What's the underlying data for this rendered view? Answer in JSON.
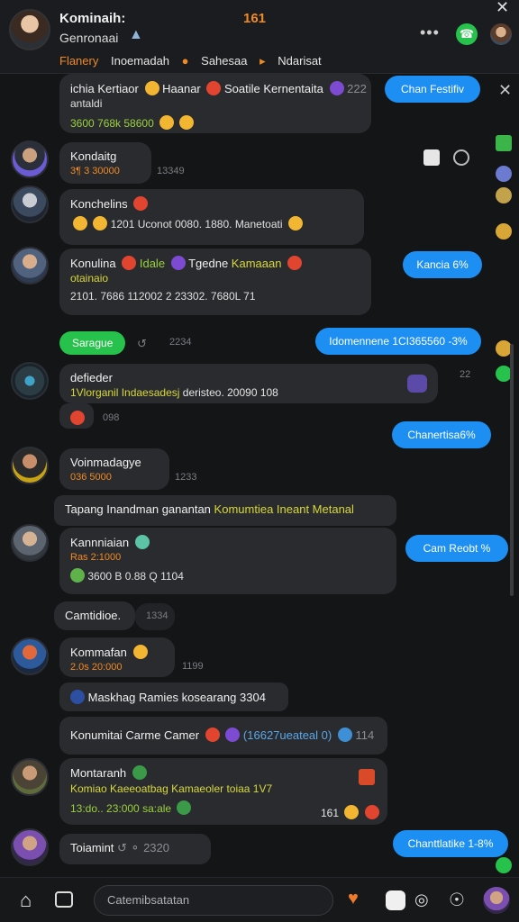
{
  "header": {
    "title": "Kominaih:",
    "count": "161",
    "subtitle": "Genronaai",
    "tabs": [
      "Flanery",
      "Inoemadah",
      "Sahesaa",
      "Ndarisat"
    ],
    "colors": {
      "accent": "#f08a24",
      "online": "#27c24c",
      "link": "#1d8ff2"
    }
  },
  "messages": [
    {
      "name": "ichia  Kertiaor",
      "extra": "Haanar",
      "line2": "antaldi",
      "stats": "3600  768k  58600",
      "extra2": "Soatile Kernentaita",
      "count": "222"
    },
    {
      "name": "Kondaitg",
      "meta": "3¶ 3 30000",
      "time": "13349"
    },
    {
      "name": "Konchelins",
      "stats": "1201  Uconot  0080.  1880.",
      "extra": "Manetoati"
    },
    {
      "name": "Konulina",
      "tag1": "Idale",
      "tag2": "Tgedne",
      "tag3": "Kamaaan",
      "line2": "otainaio",
      "stats": "2101.  7686 112002 2 23302.  7680L  71"
    },
    {
      "name": "defieder",
      "line2": "1Vlorganil Indaesadesj",
      "line3": "deristeo.  20090  108",
      "time": "098",
      "side_num": "22"
    },
    {
      "name": "Voinmadagye",
      "meta": "036 5000",
      "time": "1233"
    },
    {
      "text": "Tapang Inandman ganantan",
      "highlight": "Komumtiea Ineant Metanal"
    },
    {
      "name": "Kannniaian",
      "meta": "Ras 2:1000",
      "stats": "3600 B  0.88 Q  1104"
    },
    {
      "name": "Camtidioe.",
      "time": "1334"
    },
    {
      "name": "Kommafan",
      "meta": "2.0s 20:000",
      "time": "1199"
    },
    {
      "text": "Maskhag Ramies kosearang",
      "num": "3304"
    },
    {
      "text": "Konumitai Carme Camer",
      "mid": "(16627ueateal 0)",
      "num": "114"
    },
    {
      "name": "Montaranh",
      "line2": "Komiao Kaeeoatbag Kamaeoler toiaa 1V7",
      "stats": "13:do..  23:000 sa:ale",
      "num": "161"
    },
    {
      "name": "Toiamint",
      "time": "2320"
    }
  ],
  "pills": {
    "p1": "Chan Festifiv",
    "p2": "Kancia 6%",
    "p3": "Idomennene 1CI365560 -3%",
    "p4": "Chanertisa6%",
    "p5": "Cam Reobt %",
    "p6": "Chanttlatike 1-8%",
    "green": "Sarague",
    "green_time": "2234"
  },
  "composer": {
    "placeholder": "Catemibsatatan"
  }
}
